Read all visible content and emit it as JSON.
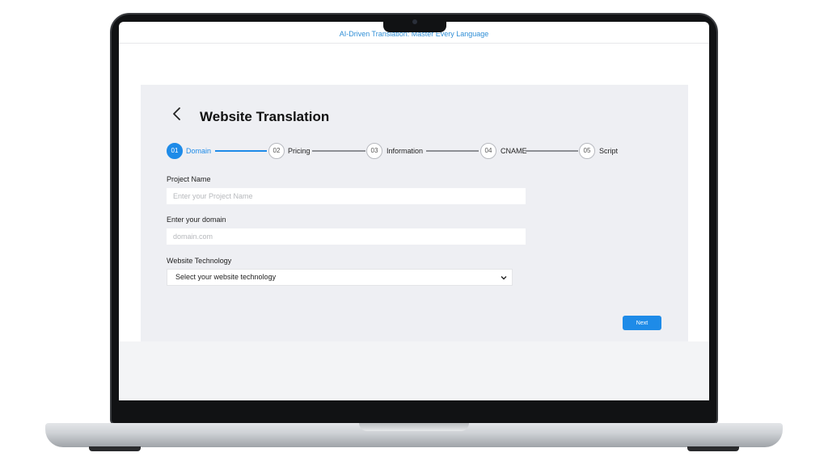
{
  "banner": {
    "text": "AI-Driven Translation: Master Every Language"
  },
  "page": {
    "title": "Website Translation",
    "back_label": ""
  },
  "stepper": {
    "steps": [
      {
        "number": "01",
        "label": "Domain",
        "active": true
      },
      {
        "number": "02",
        "label": "Pricing",
        "active": false
      },
      {
        "number": "03",
        "label": "Information",
        "active": false
      },
      {
        "number": "04",
        "label": "CNAME",
        "active": false
      },
      {
        "number": "05",
        "label": "Script",
        "active": false
      }
    ]
  },
  "form": {
    "project_name": {
      "label": "Project Name",
      "placeholder": "Enter your Project Name",
      "value": ""
    },
    "domain": {
      "label": "Enter your domain",
      "placeholder": "domain.com",
      "value": ""
    },
    "technology": {
      "label": "Website Technology",
      "selected": "Select your website technology"
    },
    "next_label": "Next"
  },
  "colors": {
    "accent": "#1e8be8",
    "card_bg": "#eeeff3",
    "banner_text": "#2f8ed6"
  },
  "icons": {
    "back": "chevron-left-icon",
    "dropdown": "chevron-down-icon"
  }
}
